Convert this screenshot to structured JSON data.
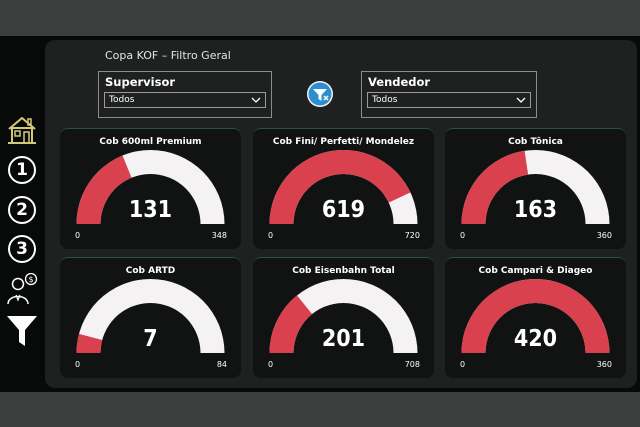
{
  "header": {
    "title": "Copa KOF – Filtro Geral"
  },
  "filters": [
    {
      "label": "Supervisor",
      "value": "Todos"
    },
    {
      "label": "Vendedor",
      "value": "Todos"
    }
  ],
  "nav": {
    "items": [
      "1",
      "2",
      "3"
    ]
  },
  "colors": {
    "accent": "#d9414f",
    "track": "#f4f2f2",
    "panel": "#1f2121",
    "card": "#111313",
    "sidebar": "#080909"
  },
  "gauges": [
    {
      "title": "Cob 600ml Premium",
      "value": 131,
      "min": 0,
      "max": 348,
      "value_label": "131",
      "min_label": "0",
      "max_label": "348"
    },
    {
      "title": "Cob Fini/ Perfetti/ Mondelez",
      "value": 619,
      "min": 0,
      "max": 720,
      "value_label": "619",
      "min_label": "0",
      "max_label": "720"
    },
    {
      "title": "Cob Tônica",
      "value": 163,
      "min": 0,
      "max": 360,
      "value_label": "163",
      "min_label": "0",
      "max_label": "360"
    },
    {
      "title": "Cob ARTD",
      "value": 7,
      "min": 0,
      "max": 84,
      "value_label": "7",
      "min_label": "0",
      "max_label": "84"
    },
    {
      "title": "Cob Eisenbahn Total",
      "value": 201,
      "min": 0,
      "max": 708,
      "value_label": "201",
      "min_label": "0",
      "max_label": "708"
    },
    {
      "title": "Cob Campari & Diageo",
      "value": 420,
      "min": 0,
      "max": 360,
      "value_label": "420",
      "min_label": "0",
      "max_label": "360"
    }
  ]
}
